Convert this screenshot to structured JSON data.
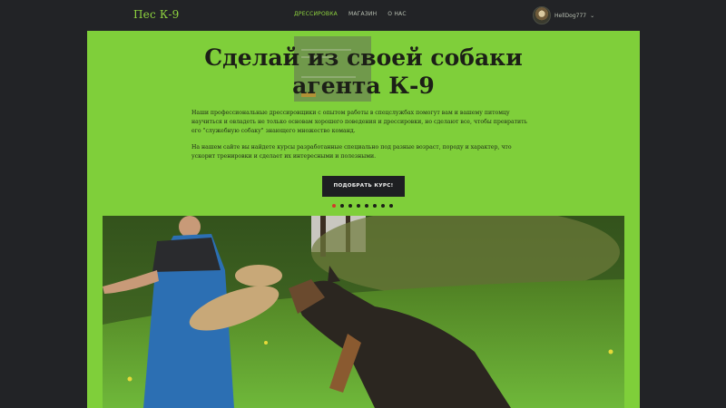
{
  "navbar": {
    "brand": "Пес К-9",
    "links": [
      {
        "label": "ДРЕССИРОВКА",
        "active": true
      },
      {
        "label": "МАГАЗИН",
        "active": false
      },
      {
        "label": "О НАС",
        "active": false
      }
    ],
    "user": {
      "name": "HellDog777",
      "chevron": "⌄",
      "avatar_icon": "dog-avatar"
    }
  },
  "hero": {
    "title_line1": "Сделай из своей собаки",
    "title_line2": "агента К-9",
    "paragraph1": "Наши профессиональные дрессировщики с опытом работы в спецслужбах помогут вам и вашему питомцу научиться и овладеть не только основам хорошего поведения и дрессировки, но сделают все, чтобы превратить его \"служебную собаку\" знающего множество команд.",
    "paragraph2": "На нашем сайте вы найдете курсы разработанные специально под разные возраст, породу и характер, что ускорит тренировки и сделает их интересными и полезными.",
    "cta_label": "ПОДОБРАТЬ КУРС!",
    "carousel_dots": 8,
    "carousel_active": 0
  },
  "colors": {
    "accent": "#8fd43f",
    "panel": "#7fcf3a",
    "background": "#222326",
    "button": "#1e1f22",
    "dot_active": "#d23a2a"
  },
  "photo": {
    "icon": "dog-training-photo"
  }
}
